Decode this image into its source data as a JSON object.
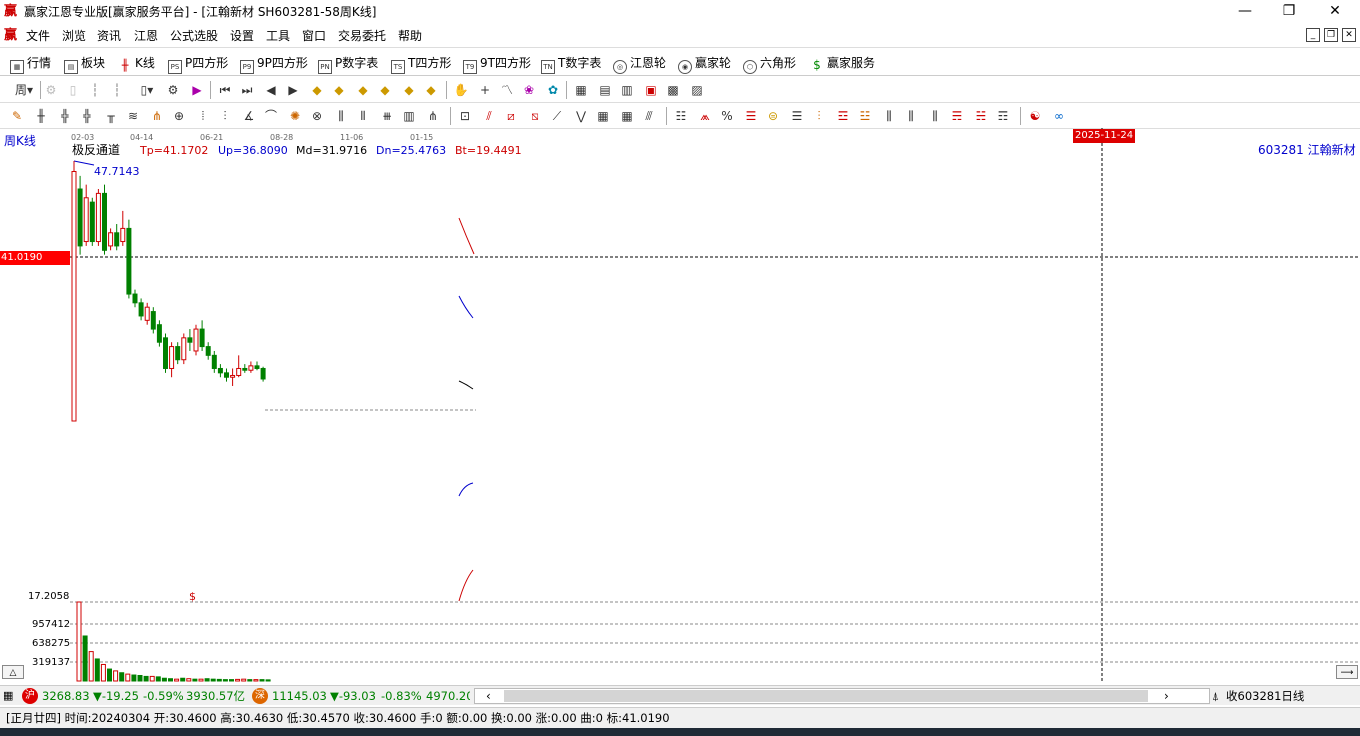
{
  "window": {
    "title": "赢家江恩专业版[赢家服务平台] - [江翰新材  SH603281-58周K线]",
    "logo": "赢",
    "minimize": "—",
    "restore": "❐",
    "close": "✕"
  },
  "menu": {
    "items": [
      "文件",
      "浏览",
      "资讯",
      "江恩",
      "公式选股",
      "设置",
      "工具",
      "窗口",
      "交易委托",
      "帮助"
    ]
  },
  "navbar": {
    "items": [
      {
        "label": "行情",
        "icon": "table-icon"
      },
      {
        "label": "板块",
        "icon": "grid-icon"
      },
      {
        "label": "K线",
        "icon": "candle-icon"
      },
      {
        "label": "P四方形",
        "icon": "ps-icon",
        "code": "PS"
      },
      {
        "label": "9P四方形",
        "icon": "p9-icon",
        "code": "P9"
      },
      {
        "label": "P数字表",
        "icon": "pn-icon",
        "code": "PN"
      },
      {
        "label": "T四方形",
        "icon": "ts-icon",
        "code": "TS"
      },
      {
        "label": "9T四方形",
        "icon": "t9-icon",
        "code": "T9"
      },
      {
        "label": "T数字表",
        "icon": "tn-icon",
        "code": "TN"
      },
      {
        "label": "江恩轮",
        "icon": "gann-wheel-icon"
      },
      {
        "label": "赢家轮",
        "icon": "winner-wheel-icon"
      },
      {
        "label": "六角形",
        "icon": "hexagon-icon"
      },
      {
        "label": "赢家服务",
        "icon": "dollar-icon"
      }
    ]
  },
  "toolbar1": {
    "period_label": "周"
  },
  "chart": {
    "panel_label": "周K线",
    "date_ticks": [
      "02-03",
      "04-14",
      "06-21",
      "08-28",
      "11-06",
      "01-15"
    ],
    "cursor_date": "2025-11-24",
    "indicator": {
      "name": "极反通道",
      "tp": "Tp=41.1702",
      "up": "Up=36.8090",
      "md": "Md=31.9716",
      "dn": "Dn=25.4763",
      "bt": "Bt=19.4491"
    },
    "stock_label": "603281  江翰新材",
    "high_label": "47.7143",
    "price_cursor": "41.0190",
    "volume_axis": [
      "17.2058",
      "957412",
      "638275",
      "319137"
    ],
    "volume_marker": "$",
    "colors": {
      "up": "#d00000",
      "down": "#008000",
      "accent": "#ff0000"
    }
  },
  "chart_data": {
    "type": "candlestick",
    "title": "",
    "x_ticks": [
      "02-03",
      "04-14",
      "06-21",
      "08-28",
      "11-06",
      "01-15"
    ],
    "y_markers": [
      47.7143,
      41.019
    ],
    "candles": [
      {
        "o": 18.0,
        "c": 46.5,
        "h": 47.7,
        "l": 18.0,
        "dir": "up"
      },
      {
        "o": 44.5,
        "c": 38.0,
        "h": 46.0,
        "l": 37.0,
        "dir": "down"
      },
      {
        "o": 38.5,
        "c": 43.5,
        "h": 45.0,
        "l": 38.0,
        "dir": "up"
      },
      {
        "o": 43.0,
        "c": 38.5,
        "h": 43.5,
        "l": 38.0,
        "dir": "down"
      },
      {
        "o": 38.5,
        "c": 44.0,
        "h": 44.5,
        "l": 38.0,
        "dir": "up"
      },
      {
        "o": 44.0,
        "c": 37.5,
        "h": 45.0,
        "l": 37.0,
        "dir": "down"
      },
      {
        "o": 38.0,
        "c": 39.5,
        "h": 40.0,
        "l": 37.5,
        "dir": "up"
      },
      {
        "o": 39.5,
        "c": 38.0,
        "h": 40.5,
        "l": 37.5,
        "dir": "down"
      },
      {
        "o": 38.5,
        "c": 40.0,
        "h": 42.0,
        "l": 38.0,
        "dir": "up"
      },
      {
        "o": 40.0,
        "c": 32.5,
        "h": 41.0,
        "l": 32.0,
        "dir": "down"
      },
      {
        "o": 32.5,
        "c": 31.5,
        "h": 33.0,
        "l": 31.0,
        "dir": "down"
      },
      {
        "o": 31.5,
        "c": 30.0,
        "h": 32.0,
        "l": 29.5,
        "dir": "down"
      },
      {
        "o": 29.5,
        "c": 31.0,
        "h": 31.5,
        "l": 29.0,
        "dir": "up"
      },
      {
        "o": 30.5,
        "c": 28.5,
        "h": 31.0,
        "l": 28.0,
        "dir": "down"
      },
      {
        "o": 29.0,
        "c": 27.0,
        "h": 29.5,
        "l": 26.5,
        "dir": "down"
      },
      {
        "o": 27.5,
        "c": 24.0,
        "h": 28.0,
        "l": 23.5,
        "dir": "down"
      },
      {
        "o": 24.0,
        "c": 26.5,
        "h": 27.0,
        "l": 23.0,
        "dir": "up"
      },
      {
        "o": 26.5,
        "c": 25.0,
        "h": 27.0,
        "l": 24.5,
        "dir": "down"
      },
      {
        "o": 25.0,
        "c": 27.5,
        "h": 28.0,
        "l": 24.5,
        "dir": "up"
      },
      {
        "o": 27.5,
        "c": 27.0,
        "h": 28.5,
        "l": 26.0,
        "dir": "down"
      },
      {
        "o": 26.0,
        "c": 28.5,
        "h": 29.0,
        "l": 25.5,
        "dir": "up"
      },
      {
        "o": 28.5,
        "c": 26.5,
        "h": 29.5,
        "l": 26.0,
        "dir": "down"
      },
      {
        "o": 26.5,
        "c": 25.5,
        "h": 27.0,
        "l": 25.0,
        "dir": "down"
      },
      {
        "o": 25.5,
        "c": 24.0,
        "h": 26.0,
        "l": 23.5,
        "dir": "down"
      },
      {
        "o": 24.0,
        "c": 23.5,
        "h": 24.5,
        "l": 23.0,
        "dir": "down"
      },
      {
        "o": 23.5,
        "c": 23.0,
        "h": 24.0,
        "l": 22.5,
        "dir": "down"
      },
      {
        "o": 23.0,
        "c": 23.2,
        "h": 24.0,
        "l": 22.0,
        "dir": "up"
      },
      {
        "o": 23.2,
        "c": 24.0,
        "h": 25.5,
        "l": 23.0,
        "dir": "up"
      },
      {
        "o": 24.0,
        "c": 23.8,
        "h": 24.5,
        "l": 23.5,
        "dir": "down"
      },
      {
        "o": 23.8,
        "c": 24.3,
        "h": 24.8,
        "l": 23.5,
        "dir": "up"
      },
      {
        "o": 24.3,
        "c": 24.0,
        "h": 24.8,
        "l": 23.8,
        "dir": "down"
      },
      {
        "o": 24.0,
        "c": 22.8,
        "h": 24.2,
        "l": 22.5,
        "dir": "down"
      }
    ],
    "volumes": [
      17.2,
      9.8,
      6.4,
      4.8,
      3.6,
      2.6,
      2.2,
      1.8,
      1.5,
      1.3,
      1.2,
      1.0,
      1.0,
      0.9,
      0.6,
      0.5,
      0.4,
      0.6,
      0.5,
      0.4,
      0.4,
      0.5,
      0.4,
      0.35,
      0.3,
      0.3,
      0.35,
      0.4,
      0.3,
      0.3,
      0.3,
      0.25
    ]
  },
  "status1": {
    "sh_badge": "沪",
    "sh_price": "3268.83",
    "sh_change": "▼-19.25",
    "sh_pct": "-0.59%",
    "sh_amount": "3930.57亿",
    "sz_badge": "深",
    "sz_price": "11145.03",
    "sz_change": "▼-93.03",
    "sz_pct": "-0.83%",
    "sz_amount": "4970.20",
    "right_label": "收603281日线"
  },
  "status2": {
    "text": "[正月廿四] 时间:20240304 开:30.4600 高:30.4630 低:30.4570 收:30.4600 手:0 额:0.00 换:0.00 涨:0.00 曲:0 标:41.0190"
  }
}
